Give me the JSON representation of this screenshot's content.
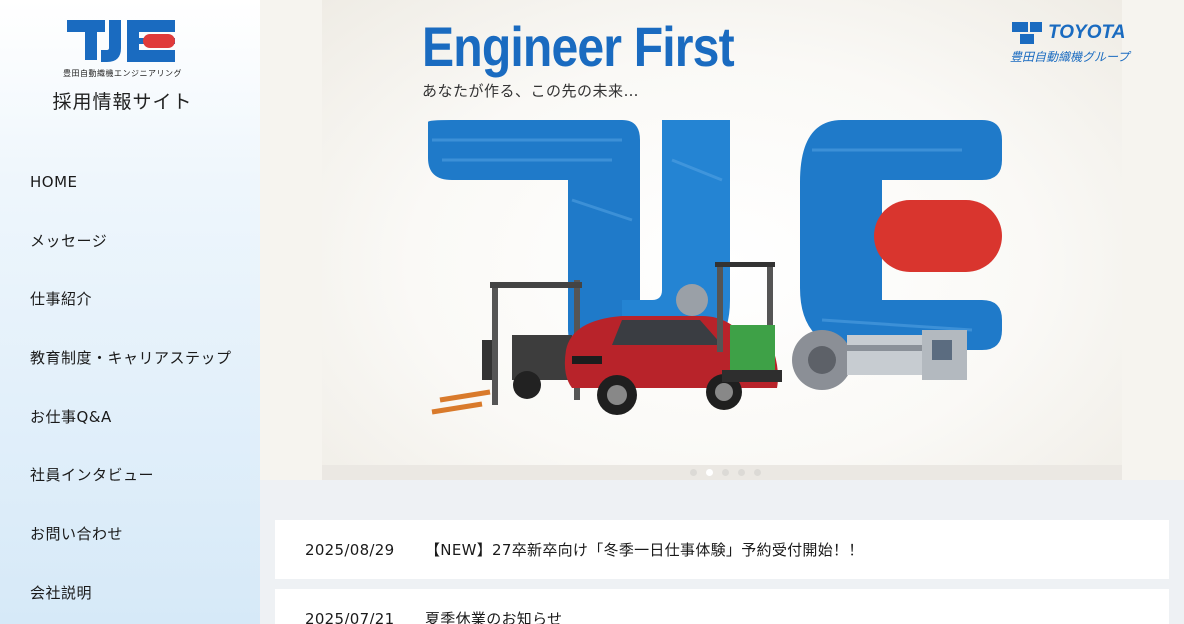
{
  "sidebar": {
    "logo_text": "TJE",
    "logo_subtitle": "豊田自動織機エンジニアリング",
    "site_title": "採用情報サイト",
    "nav": [
      {
        "label": "HOME"
      },
      {
        "label": "メッセージ"
      },
      {
        "label": "仕事紹介"
      },
      {
        "label": "教育制度・キャリアステップ"
      },
      {
        "label": "お仕事Q&A"
      },
      {
        "label": "社員インタビュー"
      },
      {
        "label": "お問い合わせ"
      },
      {
        "label": "会社説明"
      }
    ]
  },
  "hero": {
    "title": "Engineer First",
    "tagline": "あなたが作る、この先の未来…",
    "brand": "TOYOTA",
    "brand_sub": "豊田自動織機グループ",
    "art_text": "TJE",
    "slide_count": 5,
    "active_slide": 2
  },
  "news": [
    {
      "date": "2025/08/29",
      "title": "【NEW】27卒新卒向け「冬季一日仕事体験」予約受付開始！！"
    },
    {
      "date": "2025/07/21",
      "title": "夏季休業のお知らせ"
    }
  ],
  "colors": {
    "brand_blue": "#1a6bc0",
    "brand_red": "#e03a3a",
    "sidebar_gradient_end": "#d6e9f8"
  }
}
